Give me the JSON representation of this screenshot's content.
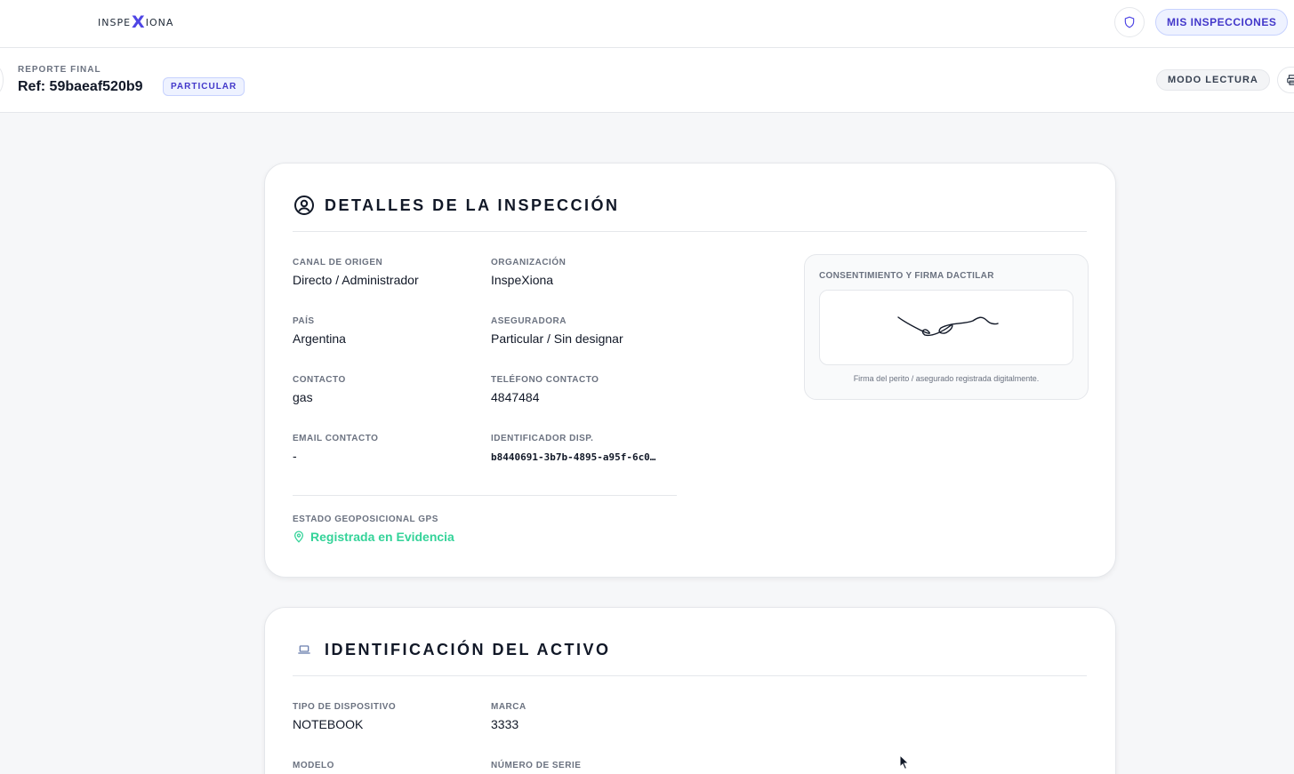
{
  "topbar": {
    "logo_pre": "INSPE",
    "logo_x": "X",
    "logo_post": "IONA",
    "mis_label": "MIS INSPECCIONES",
    "shield_icon": "shield-icon"
  },
  "subheader": {
    "label": "REPORTE FINAL",
    "ref": "Ref: 59baeaf520b9",
    "badge": "PARTICULAR",
    "read_mode": "MODO LECTURA",
    "print_icon": "printer-icon"
  },
  "details": {
    "title": "DETALLES DE LA INSPECCIÓN",
    "icon": "user-circle-icon",
    "fields": [
      {
        "label": "CANAL DE ORIGEN",
        "value": "Directo / Administrador"
      },
      {
        "label": "ORGANIZACIÓN",
        "value": "InspeXiona"
      },
      {
        "label": "PAÍS",
        "value": "Argentina"
      },
      {
        "label": "ASEGURADORA",
        "value": "Particular / Sin designar"
      },
      {
        "label": "CONTACTO",
        "value": "gas"
      },
      {
        "label": "TELÉFONO CONTACTO",
        "value": "4847484"
      },
      {
        "label": "EMAIL CONTACTO",
        "value": "-"
      },
      {
        "label": "IDENTIFICADOR DISP.",
        "value": "b8440691-3b7b-4895-a95f-6c0…"
      }
    ],
    "gps": {
      "label": "ESTADO GEOPOSICIONAL GPS",
      "value": "Registrada en Evidencia",
      "icon": "map-pin-icon"
    },
    "signature": {
      "label": "CONSENTIMIENTO Y FIRMA DACTILAR",
      "caption": "Firma del perito / asegurado registrada digitalmente."
    }
  },
  "asset": {
    "title": "IDENTIFICACIÓN DEL ACTIVO",
    "icon": "laptop-icon",
    "fields": [
      {
        "label": "TIPO DE DISPOSITIVO",
        "value": "NOTEBOOK"
      },
      {
        "label": "MARCA",
        "value": "3333"
      },
      {
        "label": "MODELO",
        "value": ""
      },
      {
        "label": "NÚMERO DE SERIE",
        "value": ""
      }
    ]
  },
  "colors": {
    "accent": "#4338ca",
    "accent_bg": "#eef2ff",
    "gps_green": "#34d399",
    "page_bg": "#f6f7f9"
  }
}
